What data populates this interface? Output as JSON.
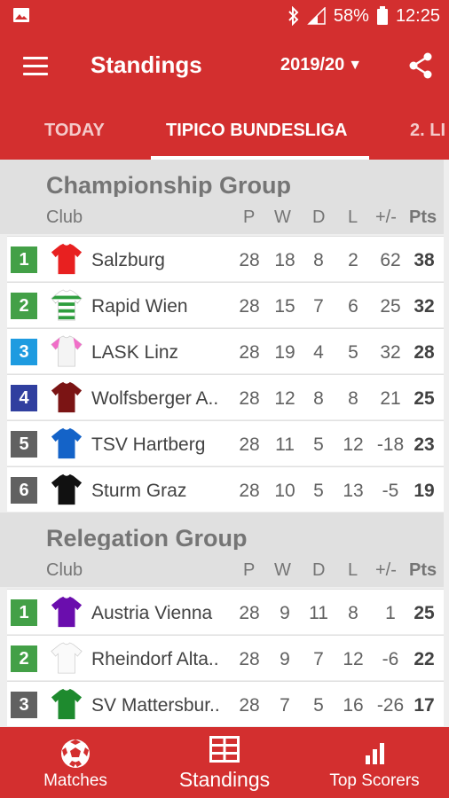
{
  "status": {
    "battery": "58%",
    "time": "12:25"
  },
  "appbar": {
    "title": "Standings",
    "season": "2019/20",
    "season_arrow": "▼"
  },
  "tabs": [
    {
      "label": "TODAY"
    },
    {
      "label": "TIPICO BUNDESLIGA"
    },
    {
      "label": "2. LI"
    }
  ],
  "columns": {
    "club": "Club",
    "p": "P",
    "w": "W",
    "d": "D",
    "l": "L",
    "gd": "+/-",
    "pts": "Pts"
  },
  "championship": {
    "title": "Championship Group",
    "rows": [
      {
        "rank": "1",
        "club": "Salzburg",
        "p": "28",
        "w": "18",
        "d": "8",
        "l": "2",
        "gd": "62",
        "pts": "38"
      },
      {
        "rank": "2",
        "club": "Rapid Wien",
        "p": "28",
        "w": "15",
        "d": "7",
        "l": "6",
        "gd": "25",
        "pts": "32"
      },
      {
        "rank": "3",
        "club": "LASK Linz",
        "p": "28",
        "w": "19",
        "d": "4",
        "l": "5",
        "gd": "32",
        "pts": "28"
      },
      {
        "rank": "4",
        "club": "Wolfsberger A..",
        "p": "28",
        "w": "12",
        "d": "8",
        "l": "8",
        "gd": "21",
        "pts": "25"
      },
      {
        "rank": "5",
        "club": "TSV Hartberg",
        "p": "28",
        "w": "11",
        "d": "5",
        "l": "12",
        "gd": "-18",
        "pts": "23"
      },
      {
        "rank": "6",
        "club": "Sturm Graz",
        "p": "28",
        "w": "10",
        "d": "5",
        "l": "13",
        "gd": "-5",
        "pts": "19"
      }
    ]
  },
  "relegation": {
    "title": "Relegation Group",
    "rows": [
      {
        "rank": "1",
        "club": "Austria Vienna",
        "p": "28",
        "w": "9",
        "d": "11",
        "l": "8",
        "gd": "1",
        "pts": "25"
      },
      {
        "rank": "2",
        "club": "Rheindorf Alta..",
        "p": "28",
        "w": "9",
        "d": "7",
        "l": "12",
        "gd": "-6",
        "pts": "22"
      },
      {
        "rank": "3",
        "club": "SV Mattersbur..",
        "p": "28",
        "w": "7",
        "d": "5",
        "l": "16",
        "gd": "-26",
        "pts": "17"
      }
    ]
  },
  "bottom_nav": [
    {
      "label": "Matches"
    },
    {
      "label": "Standings"
    },
    {
      "label": "Top Scorers"
    }
  ],
  "colors": {
    "primary": "#d32f2f",
    "rank_green": "#43a047",
    "rank_blue": "#1e9be0",
    "rank_navy": "#303f9f",
    "rank_grey": "#616161"
  }
}
